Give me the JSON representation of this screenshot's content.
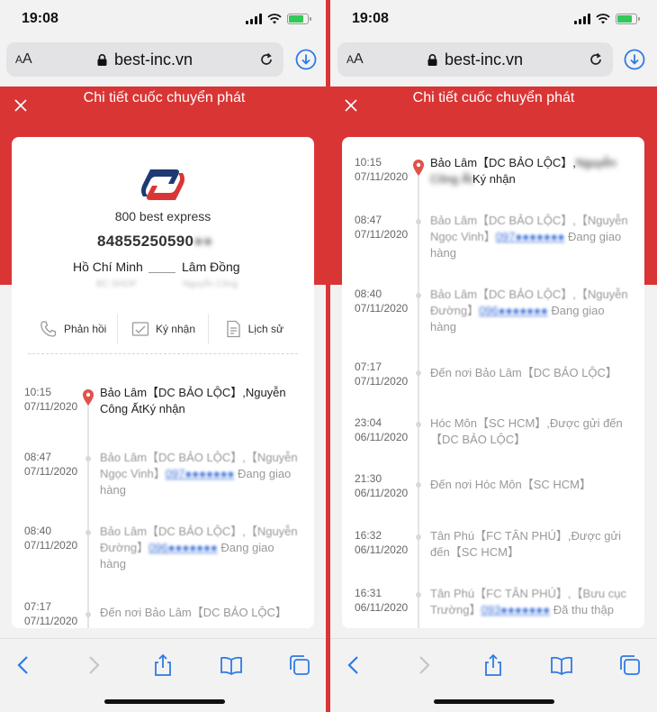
{
  "status": {
    "time": "19:08"
  },
  "browser": {
    "text_size_label": "AA",
    "url": "best-inc.vn"
  },
  "page_title": "Chi tiết cuốc chuyển phát",
  "left": {
    "brand_name": "800 best express",
    "tracking_number_visible": "84855250590",
    "tracking_number_blurred": "●●",
    "route": {
      "from": "Hồ Chí Minh",
      "to": "Lâm Đồng",
      "from_sub": "BC SHOP",
      "to_sub": "Nguyễn Công"
    },
    "actions": [
      {
        "label": "Phản hồi",
        "icon": "phone-icon"
      },
      {
        "label": "Ký nhận",
        "icon": "sign-icon"
      },
      {
        "label": "Lịch sử",
        "icon": "history-icon"
      }
    ],
    "events": [
      {
        "time": "10:15",
        "date": "07/11/2020",
        "text": "Bảo Lâm【DC BẢO LỘC】,Nguyễn Công ẤtKý nhận",
        "current": true
      },
      {
        "time": "08:47",
        "date": "07/11/2020",
        "pre": "Bảo Lâm【DC BẢO LỘC】,【Nguyễn Ngọc Vinh】",
        "phone": "097●●●●●●●",
        "post": "  Đang giao hàng"
      },
      {
        "time": "08:40",
        "date": "07/11/2020",
        "pre": "Bảo Lâm【DC BẢO LỘC】,【Nguyễn Đường】",
        "phone": "096●●●●●●●",
        "post": "  Đang giao hàng"
      },
      {
        "time": "07:17",
        "date": "07/11/2020",
        "text": "Đến nơi Bảo Lâm【DC BẢO LỘC】"
      }
    ]
  },
  "right": {
    "events": [
      {
        "time": "10:15",
        "date": "07/11/2020",
        "pre": "Bảo Lâm【DC BẢO LỘC】,",
        "blur": "Nguyễn Công Ất",
        "post": "Ký nhận",
        "current": true
      },
      {
        "time": "08:47",
        "date": "07/11/2020",
        "pre": "Bảo Lâm【DC BẢO LỘC】,【Nguyễn Ngọc Vinh】",
        "phone": "097●●●●●●●",
        "post": "  Đang giao hàng"
      },
      {
        "time": "08:40",
        "date": "07/11/2020",
        "pre": "Bảo Lâm【DC BẢO LỘC】,【Nguyễn Đường】",
        "phone": "096●●●●●●●",
        "post": "  Đang giao hàng"
      },
      {
        "time": "07:17",
        "date": "07/11/2020",
        "text": "Đến nơi Bảo Lâm【DC BẢO LỘC】"
      },
      {
        "time": "23:04",
        "date": "06/11/2020",
        "text": "Hóc Môn【SC HCM】,Được gửi đến 【DC BẢO LỘC】"
      },
      {
        "time": "21:30",
        "date": "06/11/2020",
        "text": "Đến nơi Hóc Môn【SC HCM】"
      },
      {
        "time": "16:32",
        "date": "06/11/2020",
        "text": "Tân Phú【FC TÂN PHÚ】,Được gửi đến【SC HCM】"
      },
      {
        "time": "16:31",
        "date": "06/11/2020",
        "pre": "Tân Phú【FC TÂN PHÚ】,【Bưu cục Trường】",
        "phone": "093●●●●●●●",
        "post": "  Đã thu thập"
      }
    ]
  }
}
